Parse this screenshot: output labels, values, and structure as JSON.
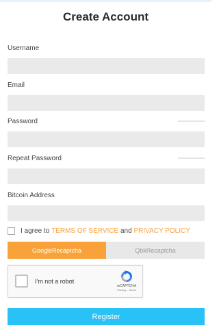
{
  "page": {
    "title": "Create Account"
  },
  "form": {
    "username_label": "Username",
    "email_label": "Email",
    "password_label": "Password",
    "repeat_password_label": "Repeat Password",
    "bitcoin_label": "Bitcoin Address",
    "username_value": "",
    "email_value": "",
    "password_value": "",
    "repeat_password_value": "",
    "bitcoin_value": ""
  },
  "agree": {
    "prefix": "I agree to",
    "terms": "TERMS OF SERVICE",
    "and": "and",
    "privacy": "PRIVACY POLICY"
  },
  "captcha_tabs": [
    {
      "label": "GoogleRecaptcha",
      "active": true
    },
    {
      "label": "QbkRecaptcha",
      "active": false
    }
  ],
  "recaptcha": {
    "label": "I'm not a robot",
    "brand": "reCAPTCHA",
    "terms": "Privacy - Terms"
  },
  "register_label": "Register",
  "colors": {
    "accent_orange": "#f9a23a",
    "link_orange": "#f8a13f",
    "button_blue": "#28c2f6",
    "field_gray": "#eaeaea"
  },
  "icons": [
    "recaptcha-logo-icon",
    "checkbox-icon"
  ]
}
